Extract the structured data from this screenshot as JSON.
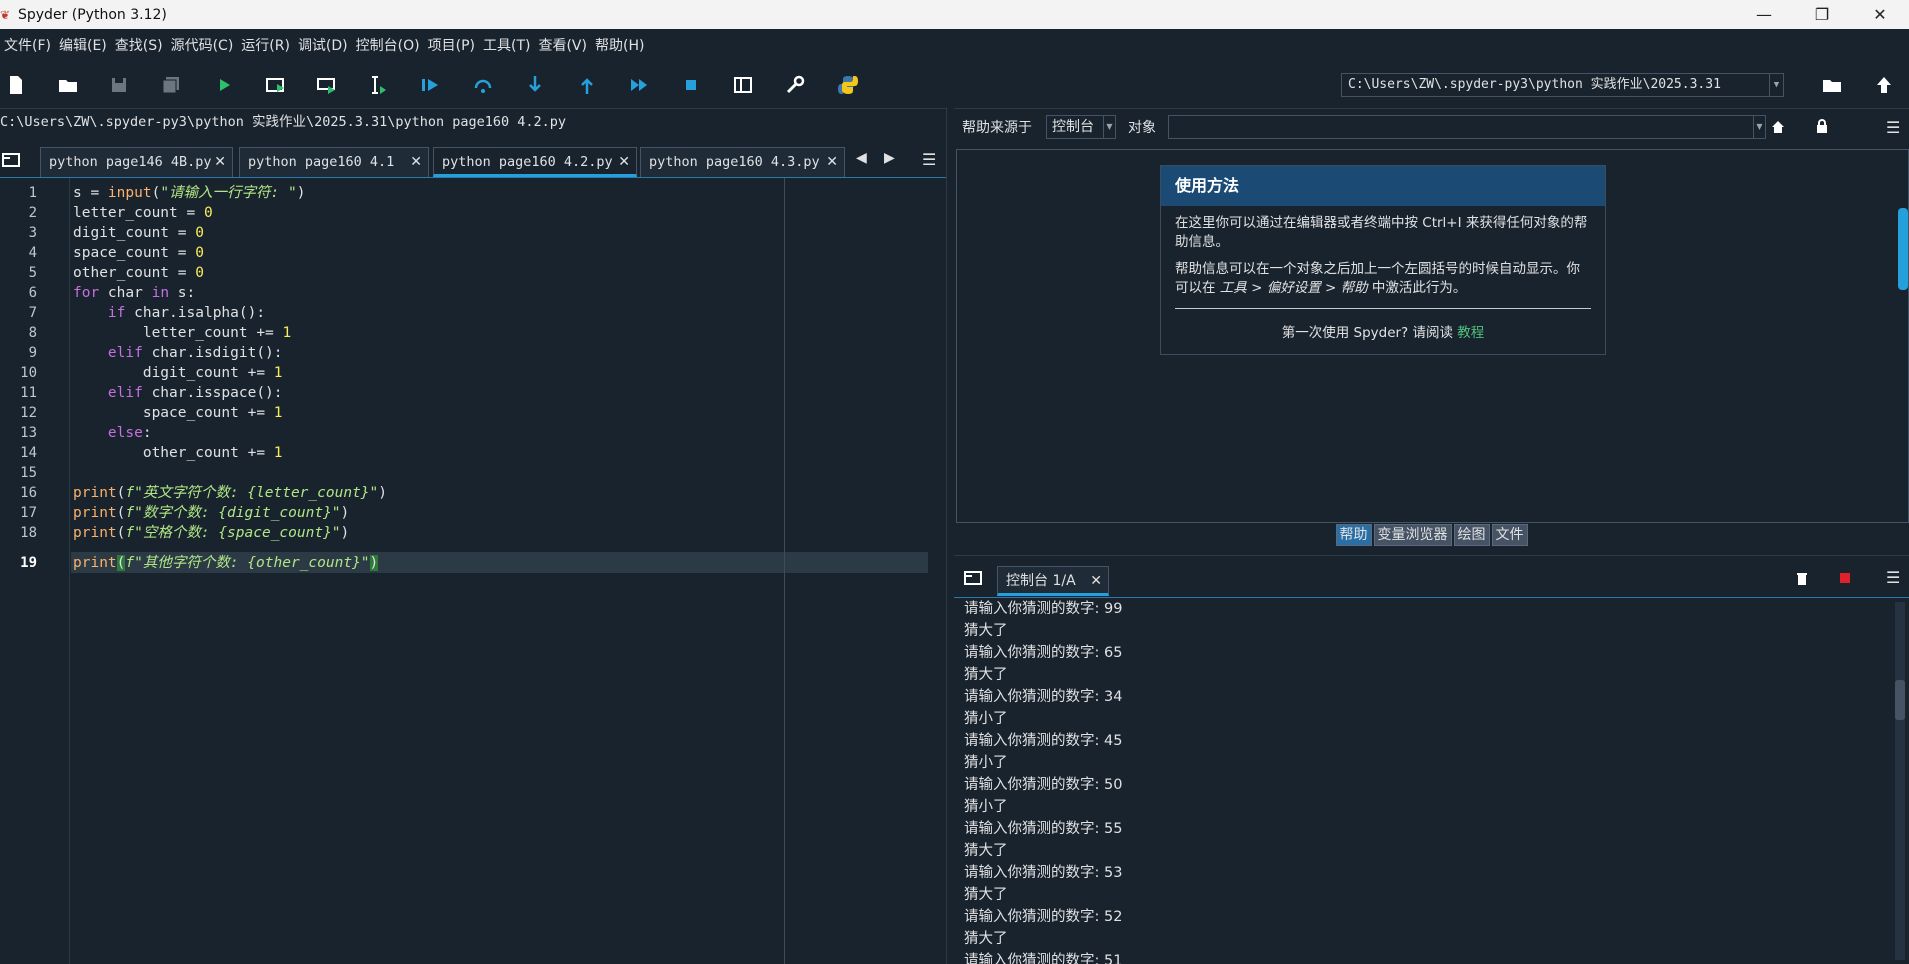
{
  "window": {
    "title": "Spyder (Python 3.12)",
    "app_icon": "spyder-icon"
  },
  "menu": [
    "文件(F)",
    "编辑(E)",
    "查找(S)",
    "源代码(C)",
    "运行(R)",
    "调试(D)",
    "控制台(O)",
    "项目(P)",
    "工具(T)",
    "查看(V)",
    "帮助(H)"
  ],
  "toolbar": {
    "working_dir": "C:\\Users\\ZW\\.spyder-py3\\python 实践作业\\2025.3.31",
    "icons": [
      "new-file-icon",
      "open-folder-icon",
      "save-icon",
      "save-all-icon",
      "run-icon",
      "run-cell-icon",
      "run-cell-advance-icon",
      "run-selection-icon",
      "debug-icon",
      "step-icon",
      "step-into-icon",
      "step-return-icon",
      "continue-icon",
      "stop-icon",
      "maximize-pane-icon",
      "preferences-wrench-icon",
      "python-path-icon",
      "browse-dir-icon",
      "parent-dir-icon"
    ]
  },
  "editor": {
    "file_path": "C:\\Users\\ZW\\.spyder-py3\\python 实践作业\\2025.3.31\\python page160 4.2.py",
    "tabs": [
      {
        "label": "python page146 4B.py",
        "active": false
      },
      {
        "label": "python  page160 4.1",
        "active": false
      },
      {
        "label": "python page160 4.2.py",
        "active": true
      },
      {
        "label": "python page160 4.3.py",
        "active": false
      }
    ],
    "current_line": 19,
    "line_numbers": [
      "1",
      "2",
      "3",
      "4",
      "5",
      "6",
      "7",
      "8",
      "9",
      "10",
      "11",
      "12",
      "13",
      "14",
      "15",
      "16",
      "17",
      "18",
      "19"
    ]
  },
  "help": {
    "source_label": "帮助来源于",
    "source_value": "控制台",
    "object_label": "对象",
    "object_value": "",
    "usage_title": "使用方法",
    "usage_p1": "在这里你可以通过在编辑器或者终端中按 Ctrl+I 来获得任何对象的帮助信息。",
    "usage_p2a": "帮助信息可以在一个对象之后加上一个左圆括号的时候自动显示。你可以在 ",
    "usage_p2b": "工具 > 偏好设置 > 帮助",
    "usage_p2c": " 中激活此行为。",
    "usage_foot": "第一次使用 Spyder? 请阅读 ",
    "usage_link": "教程"
  },
  "pane_tabs": [
    {
      "label": "帮助",
      "active": true
    },
    {
      "label": "变量浏览器",
      "active": false
    },
    {
      "label": "绘图",
      "active": false
    },
    {
      "label": "文件",
      "active": false
    }
  ],
  "console": {
    "tab_label": "控制台 1/A",
    "lines": [
      "请输入你猜测的数字: 99",
      "猜大了",
      "请输入你猜测的数字: 65",
      "猜大了",
      "请输入你猜测的数字: 34",
      "猜小了",
      "请输入你猜测的数字: 45",
      "猜小了",
      "请输入你猜测的数字: 50",
      "猜小了",
      "请输入你猜测的数字: 55",
      "猜大了",
      "请输入你猜测的数字: 53",
      "猜大了",
      "请输入你猜测的数字: 52",
      "猜大了",
      "请输入你猜测的数字: 51"
    ]
  },
  "colors": {
    "background": "#19232d",
    "accent": "#26a0da",
    "keyword": "#c670e0",
    "number": "#faed5c",
    "string": "#b0e686",
    "builtin": "#fab16c"
  }
}
